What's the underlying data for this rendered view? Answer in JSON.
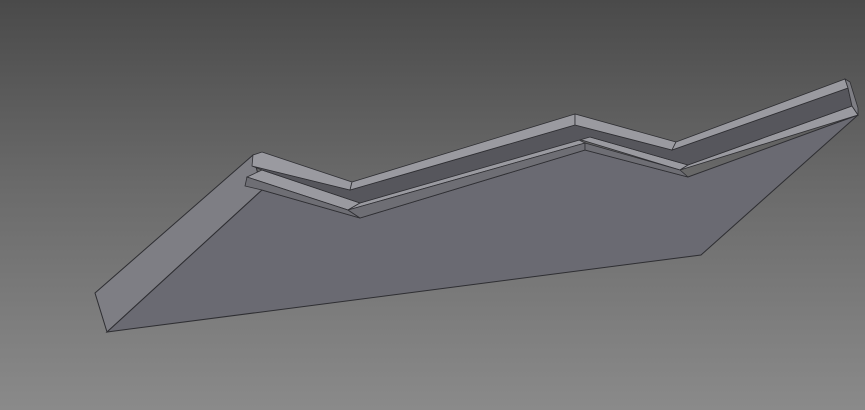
{
  "viewport": {
    "background_top": "#4a4a4a",
    "background_bottom": "#8a8a8a"
  },
  "model": {
    "object": "stepped-profile-plate",
    "colors": {
      "top_face": "#6a6a72",
      "side_face": "#76767c",
      "end_face": "#7e7e84",
      "ledge_top": "#9a9aa0",
      "ledge_front": "#6e6e74",
      "groove": "#56565c",
      "edge": "#2e2e32"
    }
  }
}
